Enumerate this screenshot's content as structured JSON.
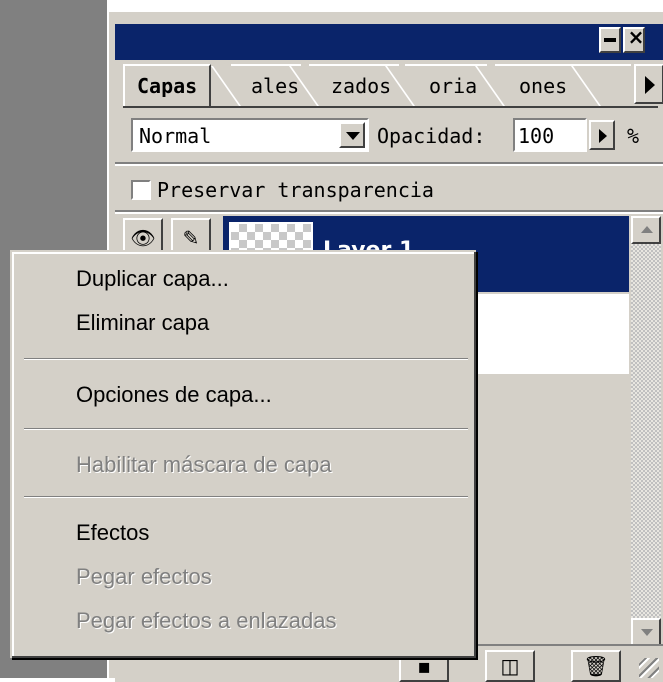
{
  "panel": {
    "tabs": [
      {
        "label": "Capas"
      },
      {
        "label": "ales"
      },
      {
        "label": "zados"
      },
      {
        "label": "oria"
      },
      {
        "label": "ones"
      }
    ],
    "blend_mode": "Normal",
    "opacity_label": "Opacidad:",
    "opacity_value": "100",
    "percent_sign": "%",
    "preserve_transparency_label": "Preservar transparencia",
    "layer_name": "Layer 1"
  },
  "context_menu": {
    "items": [
      {
        "label": "Duplicar capa...",
        "enabled": true
      },
      {
        "label": "Eliminar capa",
        "enabled": true
      },
      {
        "label": "Opciones de capa...",
        "enabled": true
      },
      {
        "label": "Habilitar máscara de capa",
        "enabled": false
      },
      {
        "label": "Efectos",
        "enabled": true
      },
      {
        "label": "Pegar efectos",
        "enabled": false
      },
      {
        "label": "Pegar efectos a enlazadas",
        "enabled": false
      }
    ]
  },
  "icons": {
    "minimize": "minimize-icon",
    "close": "close-icon",
    "tab_menu": "play-arrow-icon",
    "dropdown": "dropdown-arrow-icon",
    "eye": "eye-icon",
    "brush": "brush-icon",
    "new_layer": "new-layer-icon",
    "trash": "trash-icon",
    "scroll_up": "scroll-up-icon",
    "scroll_down": "scroll-down-icon"
  },
  "colors": {
    "titlebar": "#0a246a",
    "panel_bg": "#d4d0c8",
    "selected_layer": "#0a246a"
  }
}
